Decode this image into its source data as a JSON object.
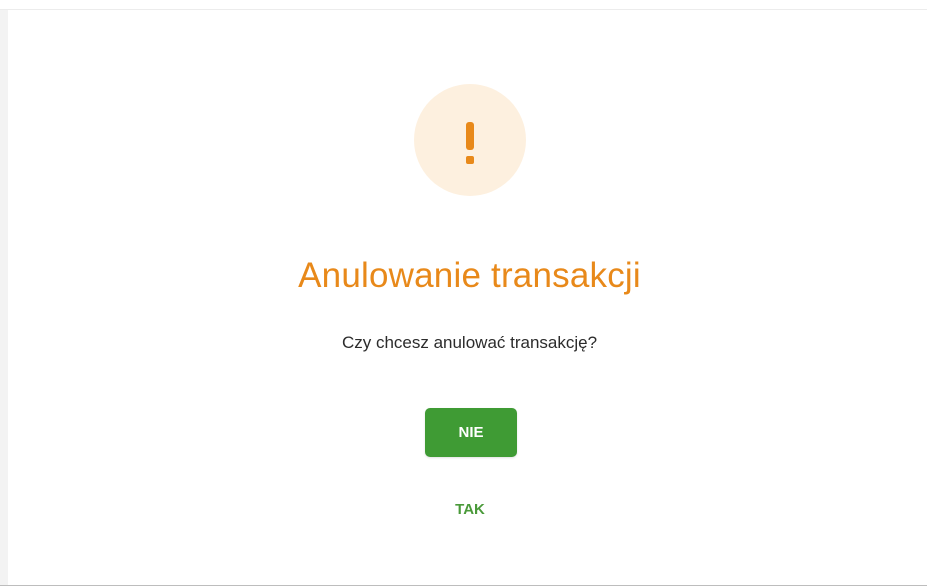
{
  "dialog": {
    "icon": "exclamation-warning-icon",
    "title": "Anulowanie transakcji",
    "message": "Czy chcesz anulować transakcję?",
    "no_label": "NIE",
    "yes_label": "TAK"
  },
  "colors": {
    "accent_orange": "#e8891a",
    "icon_background": "#fdf0df",
    "primary_green": "#3f9b34",
    "link_green": "#4a9a3a",
    "text_dark": "#2c2c2c"
  }
}
